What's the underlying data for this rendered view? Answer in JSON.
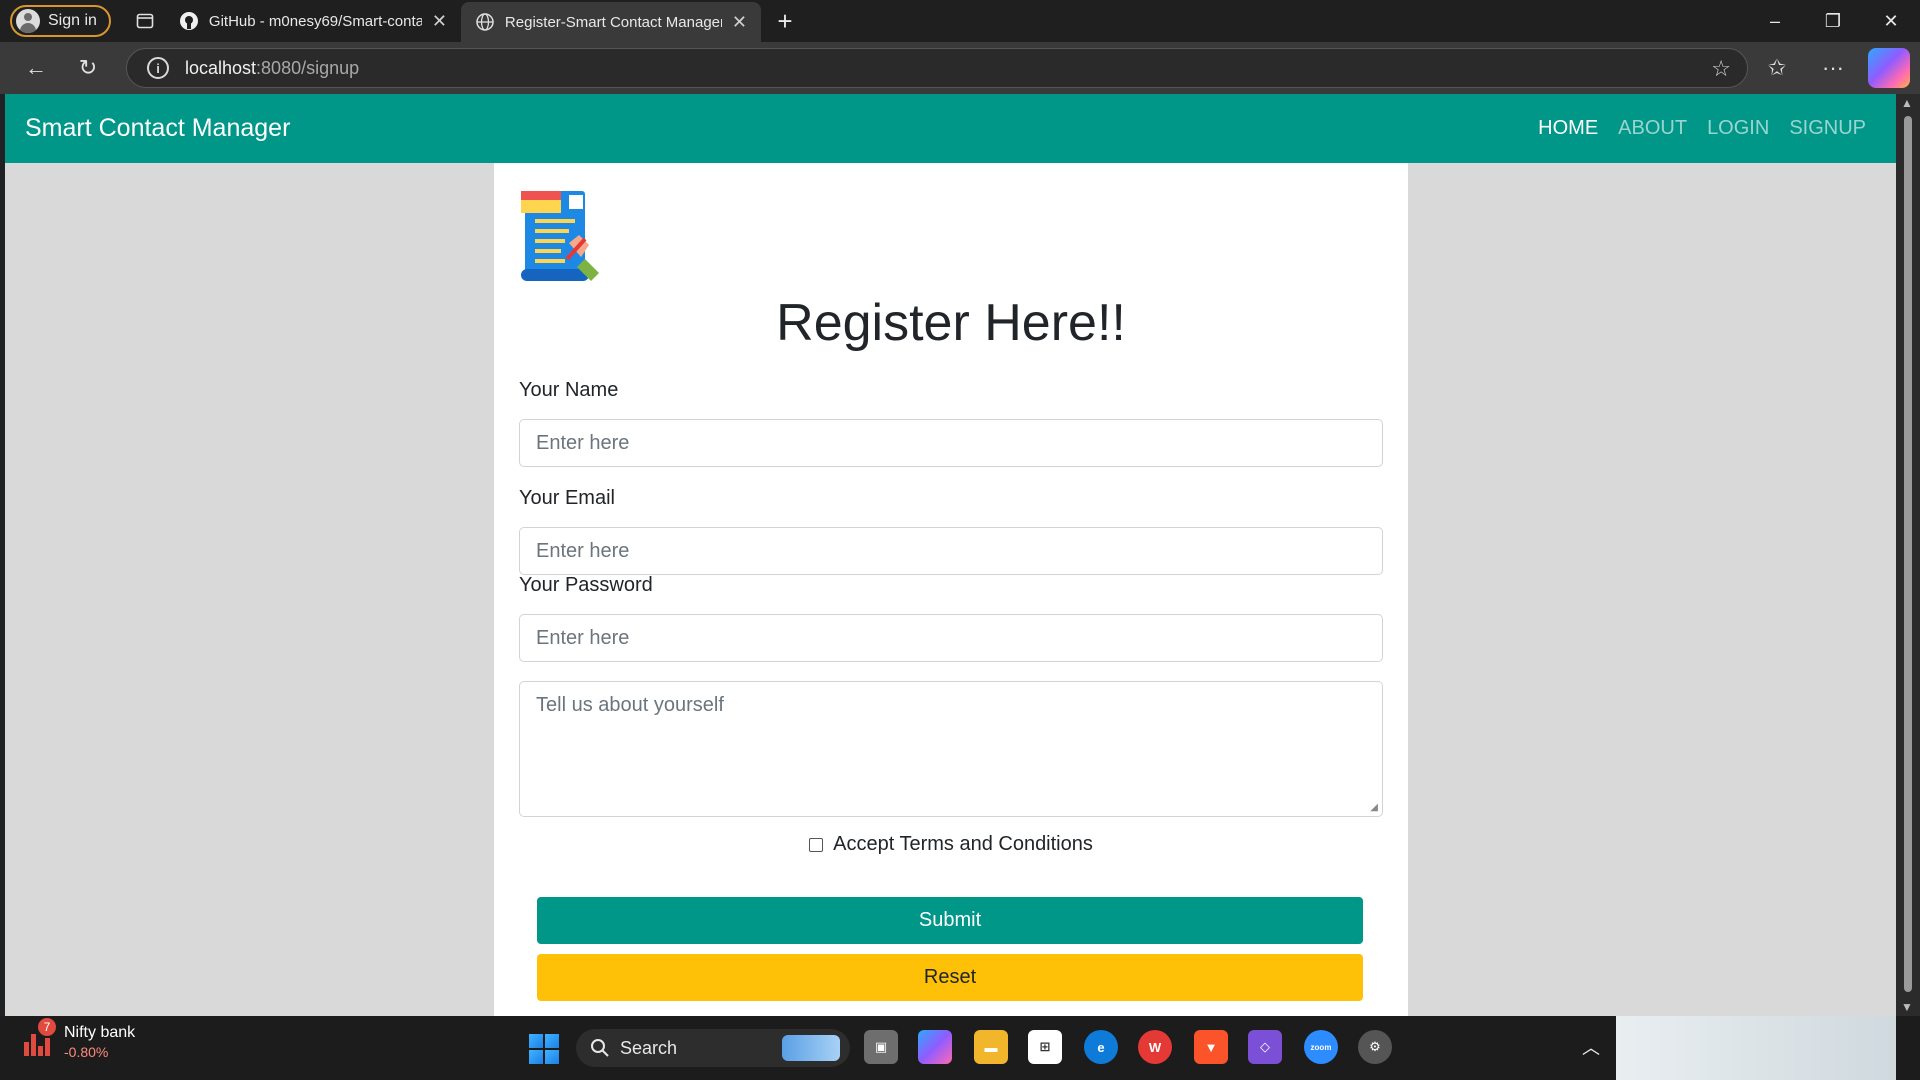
{
  "browser": {
    "signin_label": "Sign in",
    "tabs": [
      {
        "title": "GitHub - m0nesy69/Smart-contac",
        "icon": "github-icon",
        "active": false
      },
      {
        "title": "Register-Smart Contact Manager",
        "icon": "globe-icon",
        "active": true
      }
    ],
    "url_host": "localhost",
    "url_rest": ":8080/signup"
  },
  "page": {
    "brand": "Smart Contact Manager",
    "nav": [
      {
        "label": "HOME",
        "active": true
      },
      {
        "label": "ABOUT",
        "active": false
      },
      {
        "label": "LOGIN",
        "active": false
      },
      {
        "label": "SIGNUP",
        "active": false
      }
    ],
    "heading": "Register Here!!",
    "form": {
      "name_label": "Your Name",
      "name_placeholder": "Enter here",
      "email_label": "Your Email",
      "email_placeholder": "Enter here",
      "password_label": "Your Password",
      "password_placeholder": "Enter here",
      "about_placeholder": "Tell us about yourself",
      "terms_label": "Accept Terms and Conditions",
      "terms_checked": false,
      "submit_label": "Submit",
      "reset_label": "Reset"
    },
    "colors": {
      "primary": "#009688",
      "warning": "#ffc107",
      "background": "#d9d9d9"
    }
  },
  "taskbar": {
    "widget_title": "Nifty bank",
    "widget_value": "-0.80%",
    "widget_badge": "7",
    "search_label": "Search",
    "zoom_label": "zoom"
  }
}
